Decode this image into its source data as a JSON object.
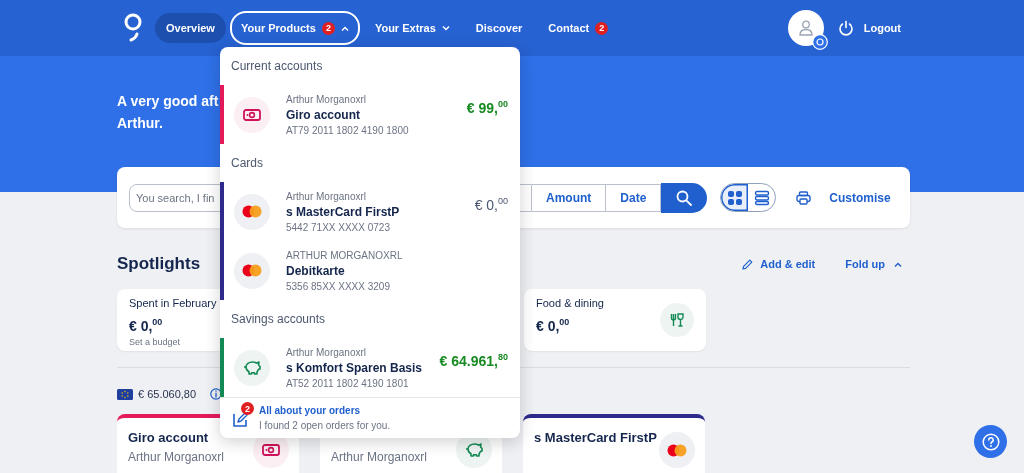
{
  "header": {
    "nav": [
      {
        "label": "Overview",
        "selected": true
      },
      {
        "label": "Your Products",
        "selected": false,
        "badge": "2",
        "expanded": true
      },
      {
        "label": "Your Extras",
        "selected": false,
        "expanded": false
      },
      {
        "label": "Discover",
        "selected": false
      },
      {
        "label": "Contact",
        "selected": false,
        "badge": "2"
      }
    ],
    "logout": "Logout"
  },
  "greeting": [
    "A very good aft",
    "Arthur."
  ],
  "search": {
    "placeholder": "You search, I fin",
    "filters": [
      "Amount",
      "Date"
    ],
    "views": [
      {
        "kind": "grid",
        "selected": true
      },
      {
        "kind": "list",
        "selected": false
      }
    ],
    "customise": "Customise"
  },
  "spotlights": {
    "title": "Spotlights",
    "actions": [
      {
        "kind": "edit",
        "label": "Add & edit"
      },
      {
        "kind": "fold",
        "label": "Fold up"
      }
    ],
    "cards": [
      {
        "kind": "budget",
        "label": "Spent in February",
        "amount": "€ 0,$^{00}$",
        "note": "Set a budget"
      },
      {
        "kind": "category",
        "label": "Food & dining",
        "amount": "€ 0,$^{00}$"
      }
    ]
  },
  "accounts": {
    "total": "€ 65.060,80",
    "cards": [
      {
        "kind": "giro",
        "name": "Giro account",
        "holder": "Arthur Morganoxrl",
        "color": "#e3195a"
      },
      {
        "kind": "savings",
        "holder": "Arthur Morganoxrl"
      },
      {
        "kind": "card",
        "name": "s MasterCard FirstP",
        "color": "#2d2a8c"
      }
    ]
  },
  "products_menu": {
    "sections": [
      {
        "title": "Current accounts",
        "color": "#e3195a",
        "accounts": [
          {
            "kind": "giro",
            "holder": "Arthur Morganoxrl",
            "name": "Giro account",
            "number": "AT79 2011 1802 4190 1800",
            "amount": "€ 99,$^{00}$",
            "color": "#178a22"
          }
        ]
      },
      {
        "title": "Cards",
        "color": "#2d2a8c",
        "accounts": [
          {
            "kind": "card",
            "holder": "Arthur Morganoxrl",
            "name": "s MasterCard FirstP",
            "number": "5442 71XX XXXX 0723",
            "amount": "€ 0,$^{00}$",
            "color": "#4c5870"
          },
          {
            "kind": "card",
            "holder": "ARTHUR MORGANOXRL",
            "name": "Debitkarte",
            "number": "5356 85XX XXXX 3209"
          }
        ]
      },
      {
        "title": "Savings accounts",
        "color": "#138a55",
        "accounts": [
          {
            "kind": "savings",
            "holder": "Arthur Morganoxrl",
            "name": "s Komfort Sparen Basis",
            "number": "AT52 2011 1802 4190 1801",
            "amount": "€ 64.961,$^{80}$",
            "color": "#178a22"
          }
        ]
      }
    ],
    "orders": {
      "badge": "2",
      "title": "All about your orders",
      "text": "I found 2 open orders for you."
    }
  }
}
